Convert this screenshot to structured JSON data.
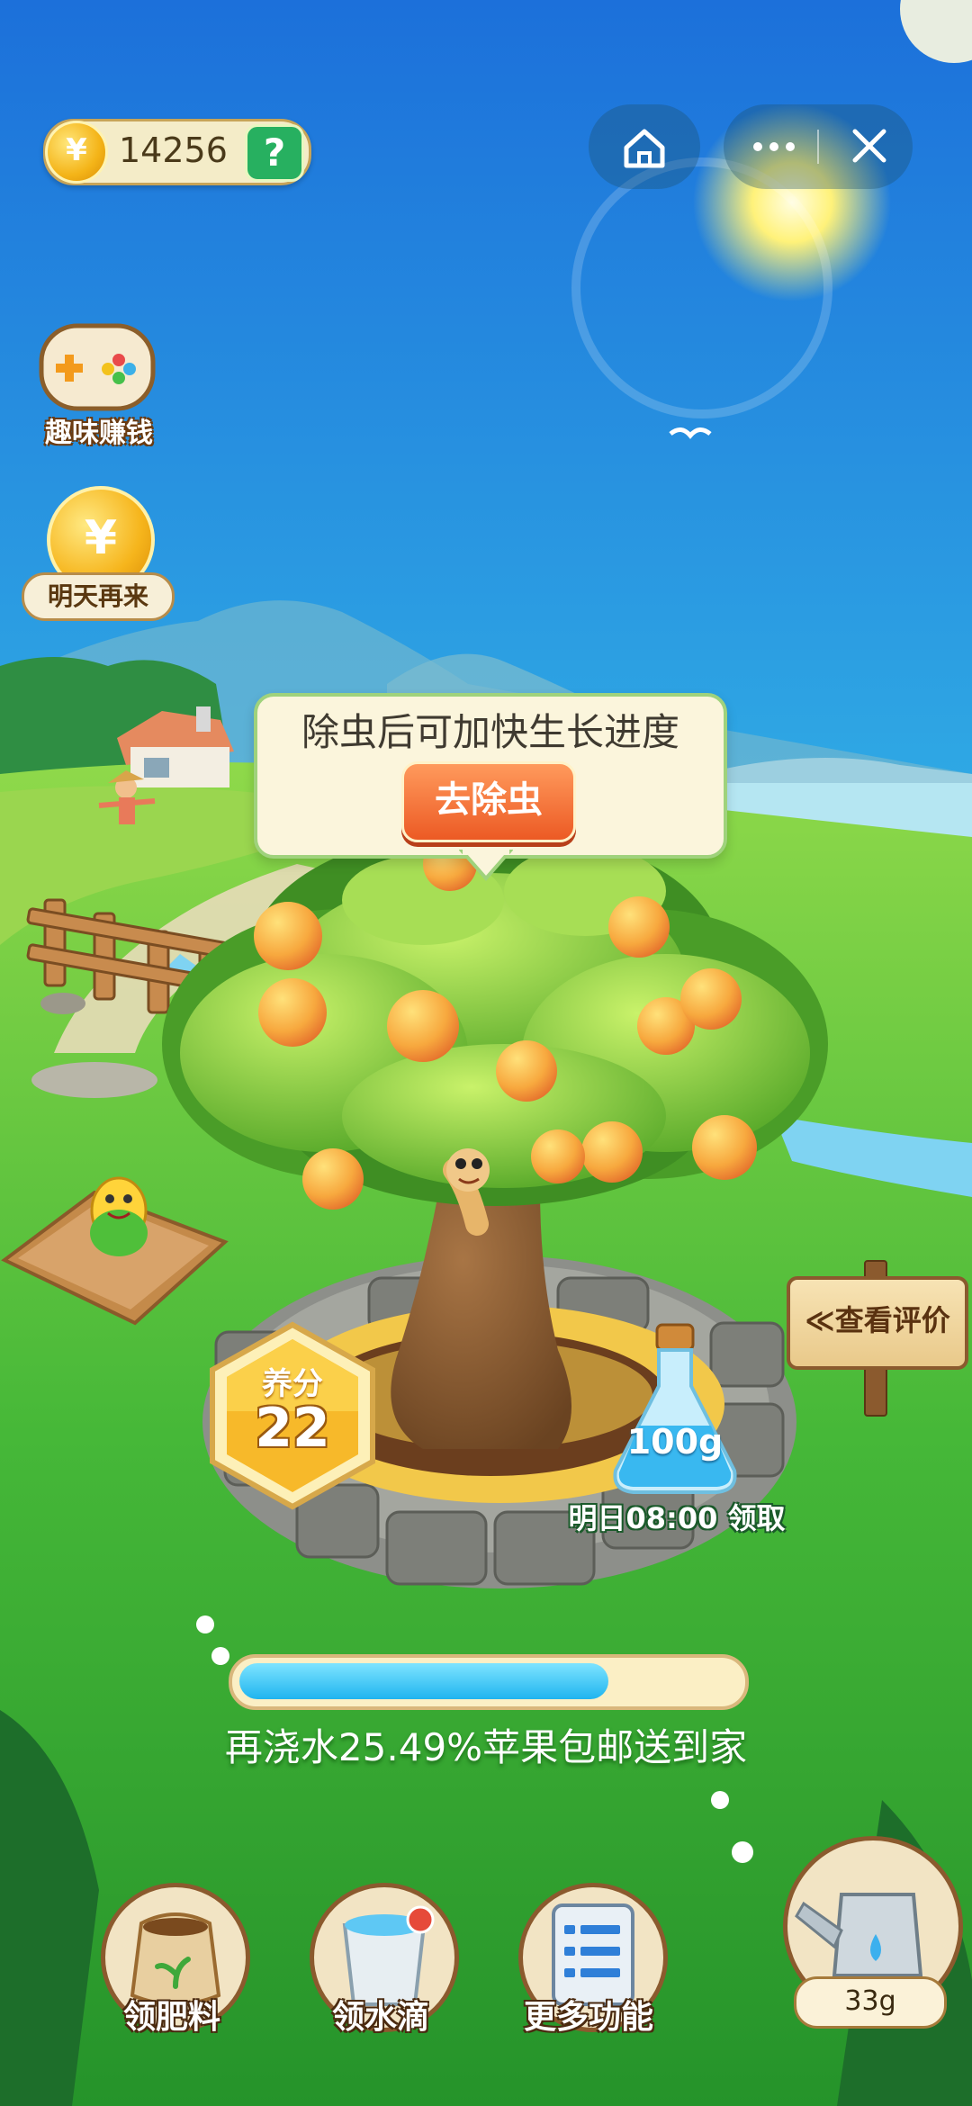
{
  "header": {
    "coin_balance": "14256",
    "coin_symbol": "¥",
    "help_symbol": "?"
  },
  "side_buttons": {
    "game_label": "趣味赚钱",
    "coin_label": "明天再来",
    "coin_symbol": "¥"
  },
  "pest_tip": {
    "message": "除虫后可加快生长进度",
    "button": "去除虫"
  },
  "review_sign": {
    "label": "≪查看评价"
  },
  "nutrient": {
    "label": "养分",
    "value": "22"
  },
  "water_bottle": {
    "amount": "100g",
    "claim_text": "明日08:00 领取"
  },
  "progress": {
    "fraction": 0.74,
    "text": "再浇水25.49%苹果包邮送到家"
  },
  "bottom_bar": {
    "fertilizer_label": "领肥料",
    "water_label": "领水滴",
    "more_label": "更多功能",
    "watering_amount": "33g"
  },
  "colors": {
    "sky_top": "#1b6fd8",
    "grass": "#3fb236",
    "accent_orange": "#ec5a24",
    "progress_blue": "#1fb4ef"
  }
}
